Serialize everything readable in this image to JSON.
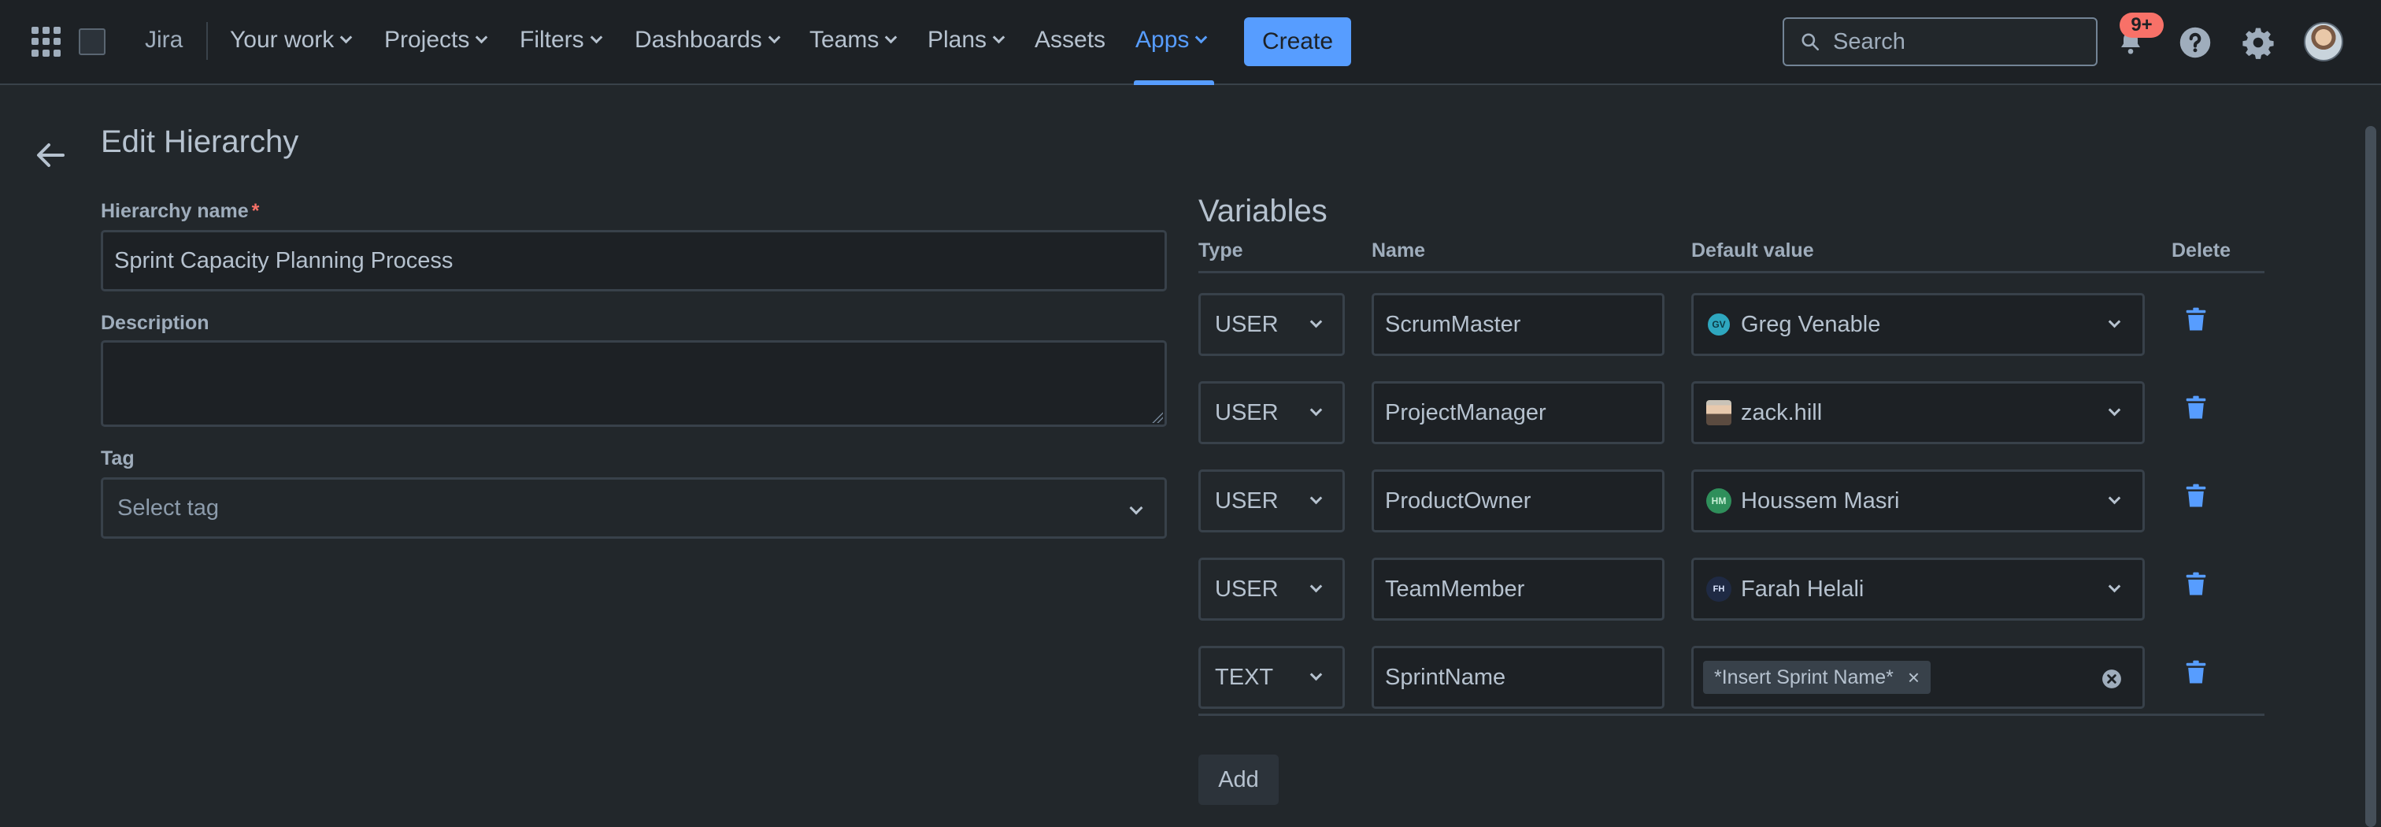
{
  "nav": {
    "brand": "Jira",
    "links": [
      "Your work",
      "Projects",
      "Filters",
      "Dashboards",
      "Teams",
      "Plans",
      "Assets",
      "Apps"
    ],
    "active": "Apps",
    "create_label": "Create",
    "search_placeholder": "Search",
    "notifications_badge": "9+"
  },
  "page": {
    "title": "Edit Hierarchy"
  },
  "form": {
    "hierarchy_name_label": "Hierarchy name",
    "required_mark": "*",
    "hierarchy_name_value": "Sprint Capacity Planning Process",
    "description_label": "Description",
    "description_value": "",
    "tag_label": "Tag",
    "tag_placeholder": "Select tag"
  },
  "variables": {
    "title": "Variables",
    "columns": {
      "type": "Type",
      "name": "Name",
      "default": "Default value",
      "delete": "Delete"
    },
    "rows": [
      {
        "type": "USER",
        "name": "ScrumMaster",
        "default": "Greg Venable",
        "initials": "GV"
      },
      {
        "type": "USER",
        "name": "ProjectManager",
        "default": "zack.hill",
        "initials": ""
      },
      {
        "type": "USER",
        "name": "ProductOwner",
        "default": "Houssem Masri",
        "initials": "HM"
      },
      {
        "type": "USER",
        "name": "TeamMember",
        "default": "Farah Helali",
        "initials": "FH"
      },
      {
        "type": "TEXT",
        "name": "SprintName",
        "default": "*Insert Sprint Name*",
        "remove_glyph": "×"
      }
    ],
    "add_label": "Add"
  },
  "colors": {
    "accent": "#579dff",
    "background": "#22272b",
    "topbar": "#1d2125",
    "danger": "#f87168"
  }
}
